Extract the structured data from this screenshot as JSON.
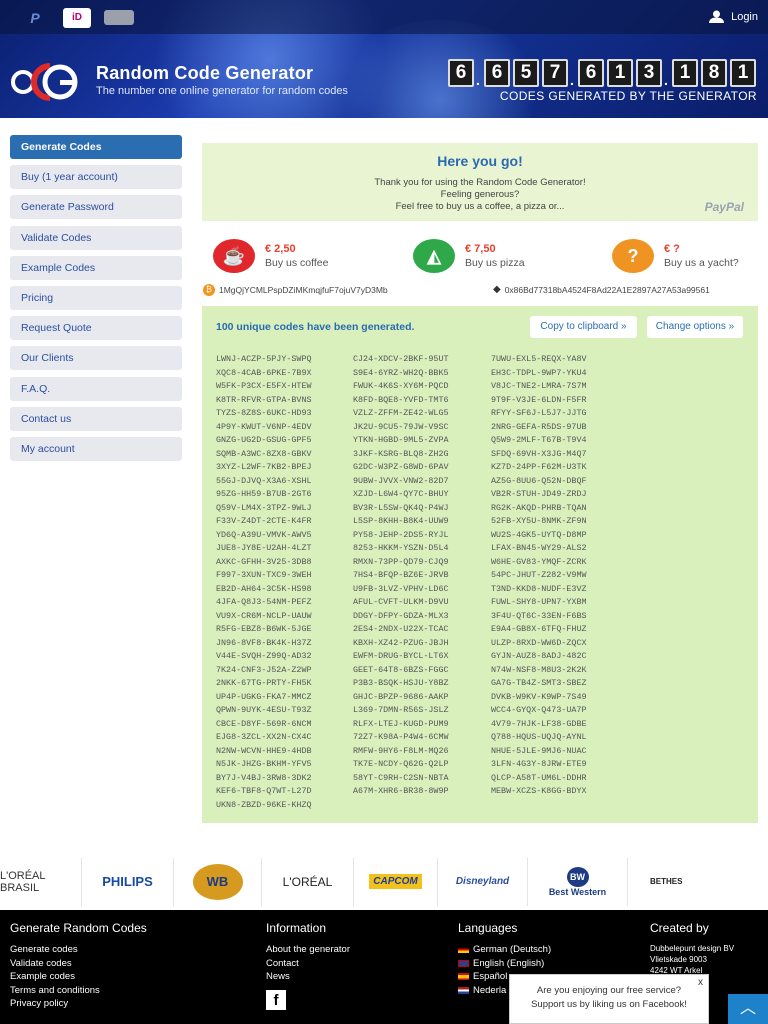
{
  "header": {
    "login": "Login",
    "title": "Random Code Generator",
    "subtitle": "The number one online generator for random codes",
    "counter_digits": [
      "6",
      "6",
      "5",
      "7",
      "6",
      "1",
      "3",
      "1",
      "8",
      "1"
    ],
    "counter_label": "CODES GENERATED BY THE GENERATOR",
    "payment_methods": [
      "paypal-icon",
      "ideal-icon",
      "creditcard-icon"
    ]
  },
  "sidebar": {
    "items": [
      {
        "label": "Generate Codes",
        "active": true
      },
      {
        "label": "Buy (1 year account)"
      },
      {
        "label": "Generate Password"
      },
      {
        "label": "Validate Codes"
      },
      {
        "label": "Example Codes"
      },
      {
        "label": "Pricing"
      },
      {
        "label": "Request Quote"
      },
      {
        "label": "Our Clients"
      },
      {
        "label": "F.A.Q."
      },
      {
        "label": "Contact us"
      },
      {
        "label": "My account"
      }
    ]
  },
  "thanks": {
    "heading": "Here you go!",
    "line1": "Thank you for using the Random Code Generator!",
    "line2": "Feeling generous?",
    "line3": "Feel free to buy us a coffee, a pizza or...",
    "paypal": "PayPal"
  },
  "donations": [
    {
      "price": "€ 2,50",
      "label": "Buy us coffee",
      "color": "#e0282c"
    },
    {
      "price": "€ 7,50",
      "label": "Buy us pizza",
      "color": "#2fa84a"
    },
    {
      "price": "€ ?",
      "label": "Buy us a yacht?",
      "color": "#ef9422"
    }
  ],
  "crypto": {
    "btc": "1MgQjYCMLPspDZiMKmqjfuF7ojuV7yD3Mb",
    "eth": "0x86Bd77318bA4524F8Ad22A1E2897A27A53a99561"
  },
  "codes": {
    "title": "100 unique codes have been generated.",
    "copy_button": "Copy to clipboard »",
    "options_button": "Change options »",
    "col1": [
      "LWNJ-ACZP-5PJY-SWPQ",
      "XQC8-4CAB-6PKE-7B9X",
      "W5FK-P3CX-E5FX-HTEW",
      "K8TR-RFVR-GTPA-BVNS",
      "TYZS-8Z8S-6UKC-HD93",
      "4P9Y-KWUT-V6NP-4EDV",
      "GNZG-UG2D-GSUG-GPF5",
      "SQMB-A3WC-8ZX8-GBKV",
      "3XYZ-L2WF-7KB2-BPEJ",
      "55GJ-DJVQ-X3A6-XSHL",
      "95ZG-HH59-B7UB-2GT6",
      "Q59V-LM4X-3TPZ-9WLJ",
      "F33V-Z4DT-2CTE-K4FR",
      "YD6Q-A39U-VMVK-AWV5",
      "JUE8-JY8E-U2AH-4LZT",
      "AXKC-GFHH-3V25-3DB8",
      "F997-3XUN-TXC9-3WEH",
      "EB2D-AH64-3C5K-HS98",
      "4JFA-Q8J3-54NM-PEFZ",
      "VU9X-CR6M-NCLP-UAUW",
      "R5FG-EBZ8-B6WK-5JGE",
      "JN96-8VF8-BK4K-H37Z",
      "V44E-SVQH-Z99Q-AD32",
      "7K24-CNF3-J52A-Z2WP",
      "2NKK-67TG-PRTY-FH5K",
      "UP4P-UGKG-FKA7-MMCZ",
      "QPWN-9UYK-4ESU-T93Z",
      "CBCE-D8YF-569R-6NCM",
      "EJG8-3ZCL-XX2N-CX4C",
      "N2NW-WCVN-HHE9-4HDB",
      "N5JK-JHZG-BKHM-YFV5",
      "BY7J-V4BJ-3RW8-3DK2",
      "KEF6-TBF8-Q7WT-L27D",
      "UKN8-ZBZD-96KE-KHZQ"
    ],
    "col2": [
      "CJ24-XDCV-2BKF-95UT",
      "S9E4-6YRZ-WH2Q-BBK5",
      "FWUK-4K6S-XY6M-PQCD",
      "K8FD-BQE8-YVFD-TMT6",
      "VZLZ-ZFFM-ZE42-WLG5",
      "JK2U-9CU5-79JW-V9SC",
      "YTKN-HGBD-9ML5-ZVPA",
      "3JKF-KSRG-BLQ8-ZH2G",
      "G2DC-W3PZ-G8WD-6PAV",
      "9UBW-JVVX-VNW2-82D7",
      "XZJD-L6W4-QY7C-BHUY",
      "BV3R-L5SW-QK4Q-P4WJ",
      "L5SP-8KHH-B8K4-UUW9",
      "PY58-JEHP-2DS5-RYJL",
      "8253-HKKM-YSZN-D5L4",
      "RMXN-73PP-QD79-CJQ9",
      "7HS4-BFQP-BZ6E-JRVB",
      "U9FB-3LVZ-VPHV-LD6C",
      "AFUL-CVFT-ULKM-D9VU",
      "DDGY-DFPY-GDZA-MLX3",
      "2ES4-2NDX-U22X-TCAC",
      "KBXH-XZ42-PZUG-JBJH",
      "EWFM-DRUG-BYCL-LT6X",
      "GEET-64T8-6BZS-FGGC",
      "P3B3-BSQK-HSJU-Y8BZ",
      "GHJC-BPZP-9686-AAKP",
      "L369-7DMN-R56S-JSLZ",
      "RLFX-LTEJ-KUGD-PUM9",
      "72Z7-K98A-P4W4-6CMW",
      "RMFW-9HY6-F8LM-MQ26",
      "TK7E-NCDY-Q62G-Q2LP",
      "58YT-C9RH-C2SN-NBTA",
      "A67M-XHR6-BR38-8W9P"
    ],
    "col3": [
      "7UWU-EXL5-REQX-YA8V",
      "EH3C-TDPL-9WP7-YKU4",
      "V8JC-TNE2-LMRA-7S7M",
      "9T9F-V3JE-6LDN-F5FR",
      "RFYY-SF6J-L5J7-JJTG",
      "2NRG-GEFA-R5DS-97UB",
      "Q5W9-2MLF-T67B-T9V4",
      "SFDQ-69VH-X3JG-M4Q7",
      "KZ7D-24PP-F62M-U3TK",
      "AZ5G-8UU6-Q52N-DBQF",
      "VB2R-STUH-JD49-ZRDJ",
      "RG2K-AKQD-PHRB-TQAN",
      "52FB-XY5U-8NMK-ZF9N",
      "WU2S-4GK5-UYTQ-D8MP",
      "LFAX-BN45-WY29-ALS2",
      "W6HE-GV83-YMQF-ZCRK",
      "54PC-JHUT-Z282-V9MW",
      "T3ND-KKD8-NUDF-E3VZ",
      "FUWL-SHY8-UPN7-YXBM",
      "3F4U-QT6C-33EN-F6BS",
      "E9A4-GB8X-6TFQ-FHUZ",
      "ULZP-8RXD-WW6D-ZQCX",
      "GYJN-AUZ8-8ADJ-482C",
      "N74W-NSF8-M8U3-2K2K",
      "GA7G-TB4Z-SMT3-SBEZ",
      "DVKB-W9KV-K9WP-7S49",
      "WCC4-GYQX-Q473-UA7P",
      "4V79-7HJK-LF38-GDBE",
      "Q788-HQUS-UQJQ-AYNL",
      "NHUE-5JLE-9MJ6-NUAC",
      "3LFN-4G3Y-8JRW-ETE9",
      "QLCP-A58T-UM6L-DDHR",
      "MEBW-XCZS-K8GG-BDYX"
    ]
  },
  "client_logos": [
    "L'ORÉAL BRASIL",
    "PHILIPS",
    "WB",
    "L'ORÉAL",
    "CAPCOM",
    "Disneyland",
    "Best Western",
    "BETHES"
  ],
  "footer": {
    "col1_heading": "Generate Random Codes",
    "col1_links": [
      "Generate codes",
      "Validate codes",
      "Example codes",
      "Terms and conditions",
      "Privacy policy"
    ],
    "col2_heading": "Information",
    "col2_links": [
      "About the generator",
      "Contact",
      "News"
    ],
    "col3_heading": "Languages",
    "col3_links": [
      {
        "label": "German (Deutsch)",
        "flag": "de"
      },
      {
        "label": "English (English)",
        "flag": "en"
      },
      {
        "label": "Español",
        "flag": "es"
      },
      {
        "label": "Nederla",
        "flag": "nl"
      }
    ],
    "col4_heading": "Created by",
    "col4_lines": [
      "Dubbelepunt design BV",
      "Vlietskade 9003",
      "4242 WT Arkel"
    ]
  },
  "popup": {
    "line1": "Are you enjoying our free service?",
    "line2": "Support us by liking us on Facebook!",
    "close": "x"
  }
}
